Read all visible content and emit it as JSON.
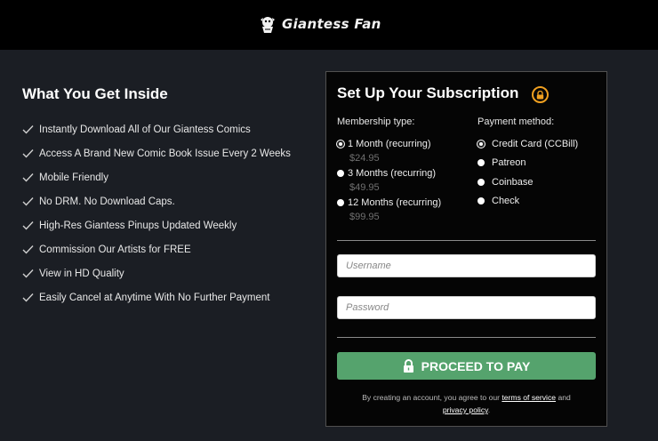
{
  "header": {
    "logo_text": "Giantess Fan",
    "logo_icon": "mascot-icon"
  },
  "benefits": {
    "title": "What You Get Inside",
    "items": [
      "Instantly Download All of Our Giantess Comics",
      "Access A Brand New Comic Book Issue Every 2 Weeks",
      "Mobile Friendly",
      "No DRM. No Download Caps.",
      "High-Res Giantess Pinups Updated Weekly",
      "Commission Our Artists for FREE",
      "View in HD Quality",
      "Easily Cancel at Anytime With No Further Payment"
    ]
  },
  "subscription": {
    "title": "Set Up Your Subscription",
    "membership_label": "Membership type:",
    "plans": [
      {
        "label": "1 Month (recurring)",
        "price": "$24.95",
        "selected": true
      },
      {
        "label": "3 Months (recurring)",
        "price": "$49.95",
        "selected": false
      },
      {
        "label": "12 Months (recurring)",
        "price": "$99.95",
        "selected": false
      }
    ],
    "payment_label": "Payment method:",
    "payment_methods": [
      {
        "label": "Credit Card (CCBill)",
        "selected": true
      },
      {
        "label": "Patreon",
        "selected": false
      },
      {
        "label": "Coinbase",
        "selected": false
      },
      {
        "label": "Check",
        "selected": false
      }
    ],
    "username_placeholder": "Username",
    "password_placeholder": "Password",
    "submit_label": "PROCEED TO PAY",
    "terms_prefix": "By creating an account, you agree to our",
    "terms_link": "terms of service",
    "terms_and": "and",
    "privacy_link": "privacy policy",
    "terms_suffix": "."
  },
  "colors": {
    "accent": "#55a36d",
    "lock": "#f0a020",
    "background": "#1b1e24"
  }
}
